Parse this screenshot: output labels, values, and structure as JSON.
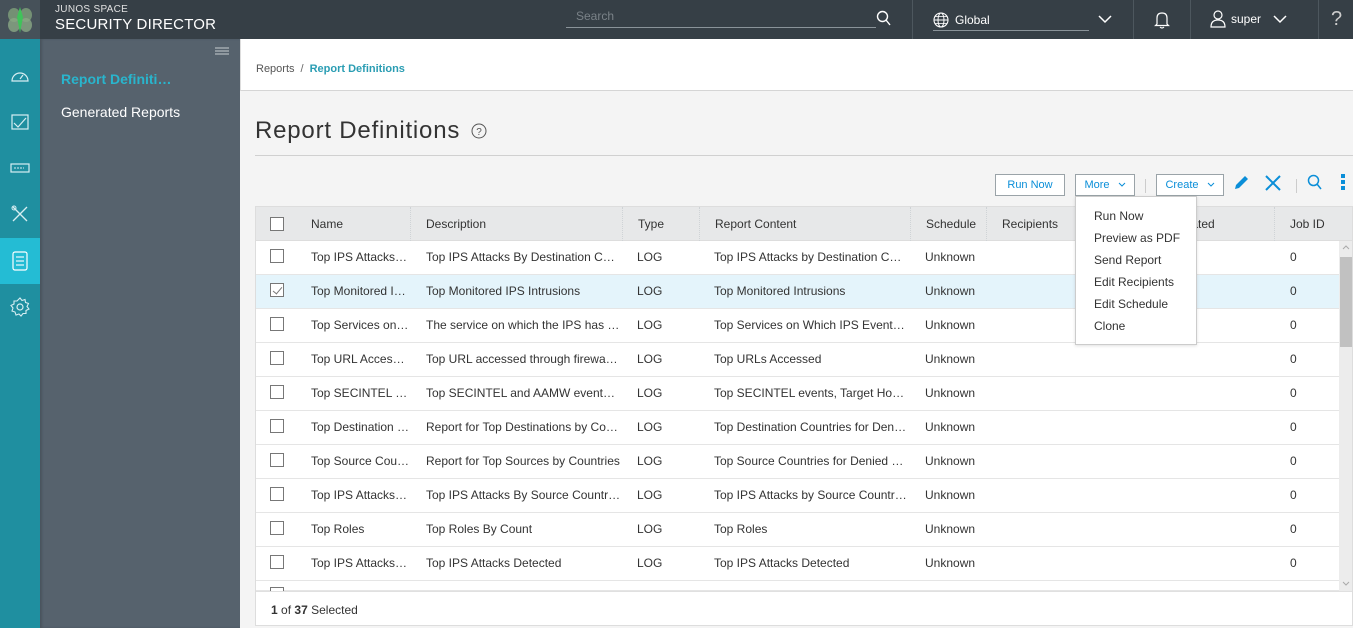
{
  "app": {
    "brand_line1": "JUNOS SPACE",
    "brand_line2": "SECURITY DIRECTOR"
  },
  "topbar": {
    "search_placeholder": "Search",
    "domain": "Global",
    "user": "super",
    "help": "?"
  },
  "iconnav": [
    {
      "name": "dashboard",
      "icon": "gauge-icon",
      "active": false
    },
    {
      "name": "monitor",
      "icon": "chart-check-icon",
      "active": false
    },
    {
      "name": "devices",
      "icon": "device-icon",
      "active": false
    },
    {
      "name": "configure",
      "icon": "tools-icon",
      "active": false
    },
    {
      "name": "reports",
      "icon": "document-icon",
      "active": true
    },
    {
      "name": "administration",
      "icon": "gear-icon",
      "active": false
    }
  ],
  "subnav": {
    "items": [
      {
        "label": "Report Definiti…",
        "active": true
      },
      {
        "label": "Generated Reports",
        "active": false
      }
    ]
  },
  "breadcrumb": {
    "parent": "Reports",
    "separator": "/",
    "current": "Report Definitions"
  },
  "page": {
    "title": "Report Definitions"
  },
  "toolbar": {
    "run_now": "Run Now",
    "more": "More",
    "create": "Create"
  },
  "more_menu": {
    "items": [
      "Run Now",
      "Preview as PDF",
      "Send Report",
      "Edit Recipients",
      "Edit Schedule",
      "Clone"
    ]
  },
  "grid": {
    "columns": [
      "Name",
      "Description",
      "Type",
      "Report Content",
      "Schedule",
      "Recipients",
      "Last Generated",
      "Job ID"
    ],
    "rows": [
      {
        "checked": false,
        "name": "Top IPS Attacks…",
        "description": "Top IPS Attacks By Destination C…",
        "type": "LOG",
        "content": "Top IPS Attacks by Destination C…",
        "schedule": "Unknown",
        "recipients": "",
        "last_generated": "",
        "job_id": "0"
      },
      {
        "checked": true,
        "name": "Top Monitored I…",
        "description": "Top Monitored IPS Intrusions",
        "type": "LOG",
        "content": "Top Monitored Intrusions",
        "schedule": "Unknown",
        "recipients": "",
        "last_generated": "",
        "job_id": "0"
      },
      {
        "checked": false,
        "name": "Top Services on…",
        "description": "The service on which the IPS has …",
        "type": "LOG",
        "content": "Top Services on Which IPS Event…",
        "schedule": "Unknown",
        "recipients": "",
        "last_generated": "",
        "job_id": "0"
      },
      {
        "checked": false,
        "name": "Top URL Acces…",
        "description": "Top URL accessed through firewa…",
        "type": "LOG",
        "content": "Top URLs Accessed",
        "schedule": "Unknown",
        "recipients": "",
        "last_generated": "",
        "job_id": "0"
      },
      {
        "checked": false,
        "name": "Top SECINTEL …",
        "description": "Top SECINTEL and AAMW event…",
        "type": "LOG",
        "content": "Top SECINTEL events, Target Ho…",
        "schedule": "Unknown",
        "recipients": "",
        "last_generated": "",
        "job_id": "0"
      },
      {
        "checked": false,
        "name": "Top Destination …",
        "description": "Report for Top Destinations by Co…",
        "type": "LOG",
        "content": "Top Destination Countries for Den…",
        "schedule": "Unknown",
        "recipients": "",
        "last_generated": "",
        "job_id": "0"
      },
      {
        "checked": false,
        "name": "Top Source Cou…",
        "description": "Report for Top Sources by Countries",
        "type": "LOG",
        "content": "Top Source Countries for Denied …",
        "schedule": "Unknown",
        "recipients": "",
        "last_generated": "",
        "job_id": "0"
      },
      {
        "checked": false,
        "name": "Top IPS Attacks…",
        "description": "Top IPS Attacks By Source Countr…",
        "type": "LOG",
        "content": "Top IPS Attacks by Source Countr…",
        "schedule": "Unknown",
        "recipients": "",
        "last_generated": "",
        "job_id": "0"
      },
      {
        "checked": false,
        "name": "Top Roles",
        "description": "Top Roles By Count",
        "type": "LOG",
        "content": "Top Roles",
        "schedule": "Unknown",
        "recipients": "",
        "last_generated": "",
        "job_id": "0"
      },
      {
        "checked": false,
        "name": "Top IPS Attacks…",
        "description": "Top IPS Attacks Detected",
        "type": "LOG",
        "content": "Top IPS Attacks Detected",
        "schedule": "Unknown",
        "recipients": "",
        "last_generated": "",
        "job_id": "0"
      }
    ],
    "footer": {
      "selected": "1",
      "of_label": "of",
      "total": "37",
      "suffix": "Selected"
    }
  },
  "colors": {
    "accent": "#29b5cd",
    "topbar": "#363f46",
    "iconnav": "#1f8fa0",
    "iconnav_active": "#24bcd4",
    "subnav": "#56626d",
    "link_blue": "#0a8ed8"
  }
}
